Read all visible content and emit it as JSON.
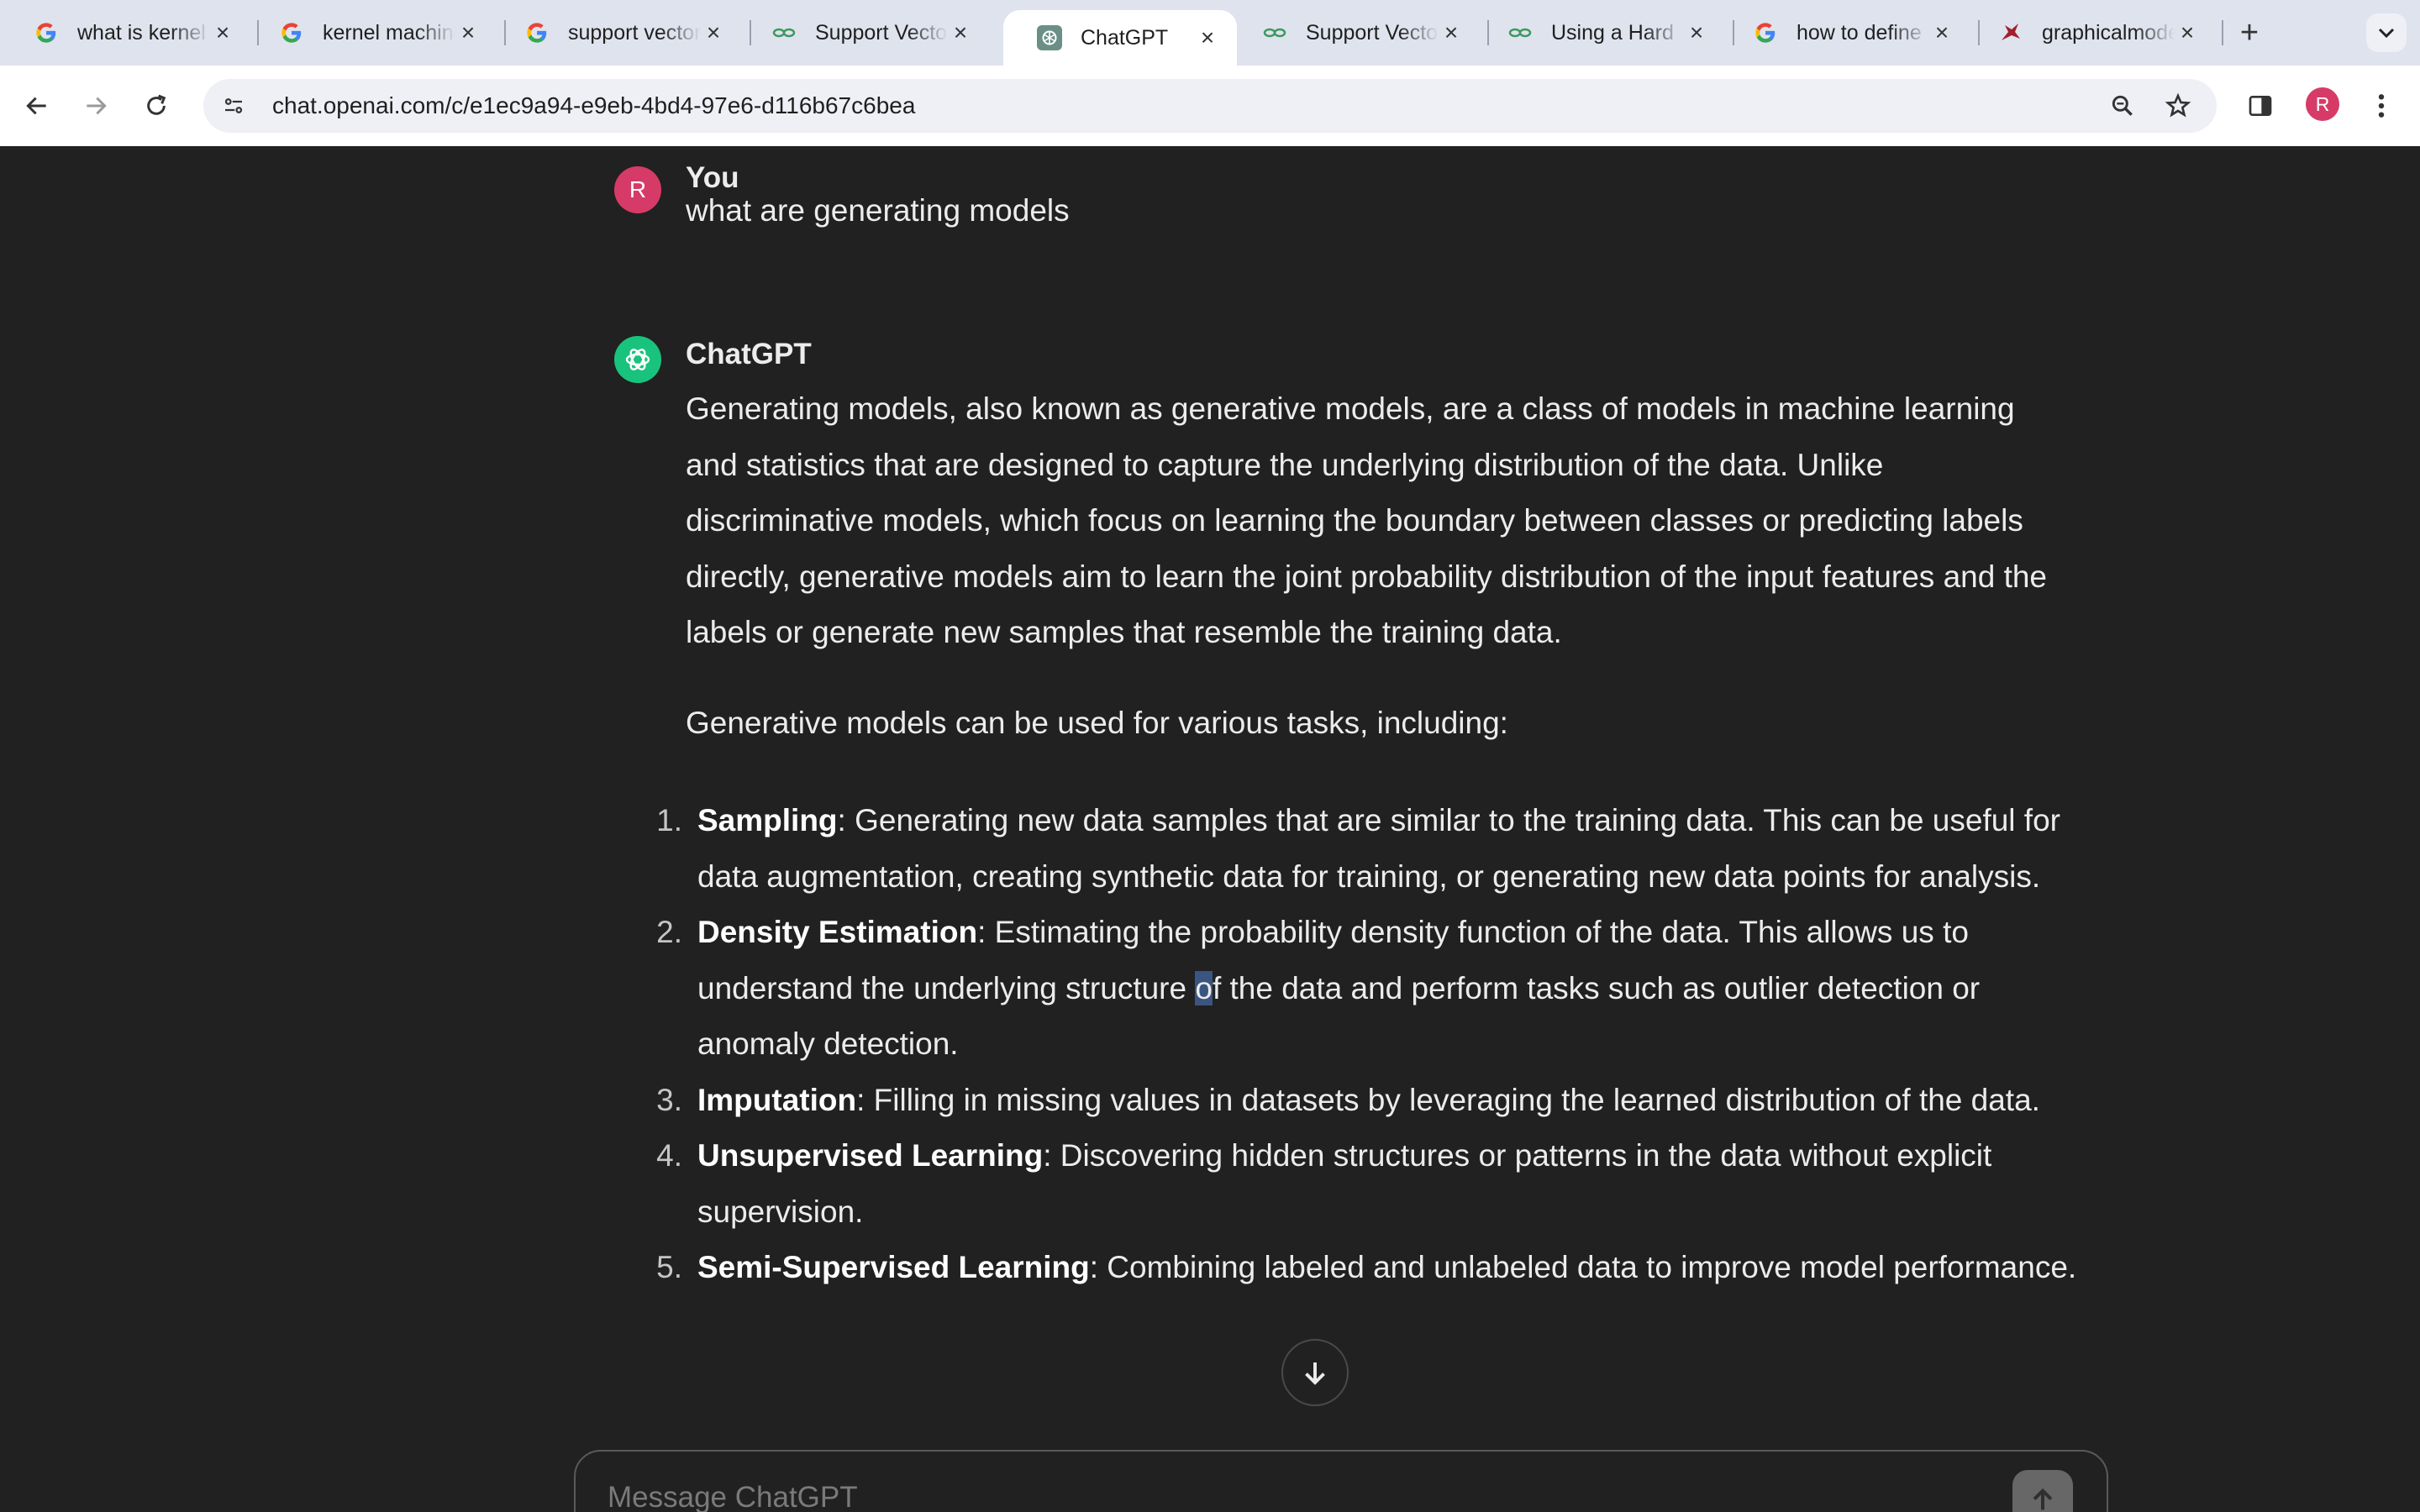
{
  "browser": {
    "tabs": [
      {
        "title": "what is kernel machine",
        "favicon": "google-icon",
        "active": false
      },
      {
        "title": "kernel machine",
        "favicon": "google-icon",
        "active": false
      },
      {
        "title": "support vector",
        "favicon": "google-icon",
        "active": false
      },
      {
        "title": "Support Vector",
        "favicon": "chain-icon",
        "active": false
      },
      {
        "title": "ChatGPT",
        "favicon": "chatgpt-icon",
        "active": true
      },
      {
        "title": "Support Vector",
        "favicon": "chain-icon",
        "active": false
      },
      {
        "title": "Using a Hard",
        "favicon": "chain-icon",
        "active": false
      },
      {
        "title": "how to define",
        "favicon": "google-icon",
        "active": false
      },
      {
        "title": "graphicalmodels",
        "favicon": "bird-icon",
        "active": false
      }
    ],
    "url": "chat.openai.com/c/e1ec9a94-e9eb-4bd4-97e6-d116b67c6bea",
    "profile_initial": "R"
  },
  "conversation": {
    "user": {
      "initial": "R",
      "name": "You",
      "message": "what are generating models"
    },
    "assistant": {
      "name": "ChatGPT",
      "paragraphs": [
        "Generating models, also known as generative models, are a class of models in machine learning and statistics that are designed to capture the underlying distribution of the data. Unlike discriminative models, which focus on learning the boundary between classes or predicting labels directly, generative models aim to learn the joint probability distribution of the input features and the labels or generate new samples that resemble the training data.",
        "Generative models can be used for various tasks, including:"
      ],
      "list": [
        {
          "num": "1.",
          "term": "Sampling",
          "text": ": Generating new data samples that are similar to the training data. This can be useful for data augmentation, creating synthetic data for training, or generating new data points for analysis."
        },
        {
          "num": "2.",
          "term": "Density Estimation",
          "text_before": ": Estimating the probability density function of the data. This allows us to understand the underlying structure ",
          "highlight": "o",
          "text_after": "f the data and perform tasks such as outlier detection or anomaly detection."
        },
        {
          "num": "3.",
          "term": "Imputation",
          "text": ": Filling in missing values in datasets by leveraging the learned distribution of the data."
        },
        {
          "num": "4.",
          "term": "Unsupervised Learning",
          "text": ": Discovering hidden structures or patterns in the data without explicit supervision."
        },
        {
          "num": "5.",
          "term": "Semi-Supervised Learning",
          "text": ": Combining labeled and unlabeled data to improve model performance."
        }
      ]
    }
  },
  "composer": {
    "placeholder": "Message ChatGPT"
  },
  "colors": {
    "chat_background": "#212121",
    "user_avatar": "#d63b67",
    "assistant_avatar": "#19c37d",
    "text_selection": "#3a5580"
  }
}
